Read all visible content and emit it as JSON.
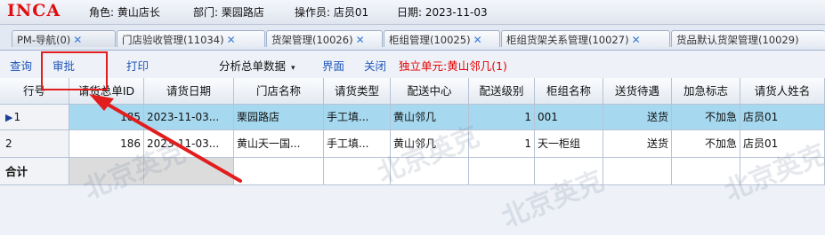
{
  "brand": "INCA",
  "header": {
    "role": "角色: 黄山店长",
    "dept": "部门: 栗园路店",
    "operator": "操作员: 店员01",
    "date": "日期: 2023-11-03"
  },
  "tabs": [
    {
      "label": "PM-导航(0)",
      "close": "✕"
    },
    {
      "label": "门店验收管理(11034)",
      "close": "✕"
    },
    {
      "label": "货架管理(10026)",
      "close": "✕"
    },
    {
      "label": "柜组管理(10025)",
      "close": "✕"
    },
    {
      "label": "柜组货架关系管理(10027)",
      "close": "✕"
    },
    {
      "label": "货品默认货架管理(10029)",
      "close": ""
    }
  ],
  "toolbar": {
    "query": "查询",
    "approve": "审批",
    "print": "打印",
    "summary": "分析总单数据",
    "dropdown_caret": "▾",
    "view": "界面",
    "close": "关闭",
    "unit": "独立单元:黄山邻几(1)"
  },
  "table": {
    "headers": [
      "行号",
      "请货总单ID",
      "请货日期",
      "门店名称",
      "请货类型",
      "配送中心",
      "配送级别",
      "柜组名称",
      "送货待遇",
      "加急标志",
      "请货人姓名"
    ],
    "rows": [
      {
        "row_no": "1",
        "marker": "▶",
        "id": "185",
        "date": "2023-11-03...",
        "store": "栗园路店",
        "type": "手工填...",
        "center": "黄山邻几",
        "level": "1",
        "group": "001",
        "delivery": "送货",
        "urgent": "不加急",
        "requester": "店员01"
      },
      {
        "row_no": "2",
        "marker": "",
        "id": "186",
        "date": "2023-11-03...",
        "store": "黄山天一国...",
        "type": "手工填...",
        "center": "黄山邻几",
        "level": "1",
        "group": "天一柜组",
        "delivery": "送货",
        "urgent": "不加急",
        "requester": "店员01"
      }
    ],
    "total_label": "合计"
  },
  "watermark": "北京英克",
  "colors": {
    "accent": "#1f56b8",
    "brand": "#e00f0f",
    "selected_row": "#a6d9ef",
    "annotation": "#e21d1d"
  }
}
